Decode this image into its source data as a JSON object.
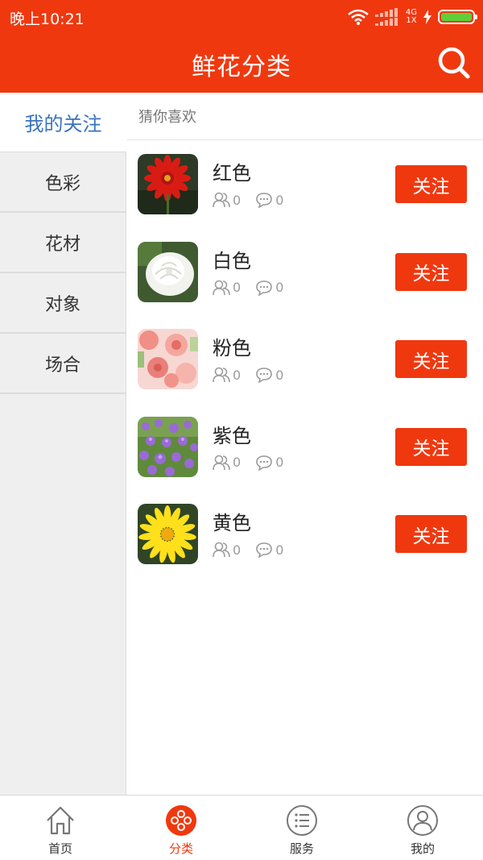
{
  "status_bar": {
    "time": "晚上10:21",
    "network_top": "4G",
    "network_bottom": "1X",
    "battery_level": 1.0
  },
  "header": {
    "title": "鲜花分类",
    "search_icon": "search-icon"
  },
  "sidebar": {
    "active": "我的关注",
    "items": [
      {
        "label": "色彩"
      },
      {
        "label": "花材"
      },
      {
        "label": "对象"
      },
      {
        "label": "场合"
      }
    ]
  },
  "main": {
    "section_label": "猜你喜欢",
    "items": [
      {
        "name": "红色",
        "followers": "0",
        "comments": "0",
        "button": "关注"
      },
      {
        "name": "白色",
        "followers": "0",
        "comments": "0",
        "button": "关注"
      },
      {
        "name": "粉色",
        "followers": "0",
        "comments": "0",
        "button": "关注"
      },
      {
        "name": "紫色",
        "followers": "0",
        "comments": "0",
        "button": "关注"
      },
      {
        "name": "黄色",
        "followers": "0",
        "comments": "0",
        "button": "关注"
      }
    ]
  },
  "tabbar": {
    "tabs": [
      {
        "label": "首页",
        "icon": "home-icon"
      },
      {
        "label": "分类",
        "icon": "category-icon"
      },
      {
        "label": "服务",
        "icon": "list-icon"
      },
      {
        "label": "我的",
        "icon": "user-icon"
      }
    ],
    "active_index": 1
  },
  "colors": {
    "brand": "#f0380f",
    "sidebar_active_text": "#3a73be",
    "battery": "#5fcf39"
  }
}
